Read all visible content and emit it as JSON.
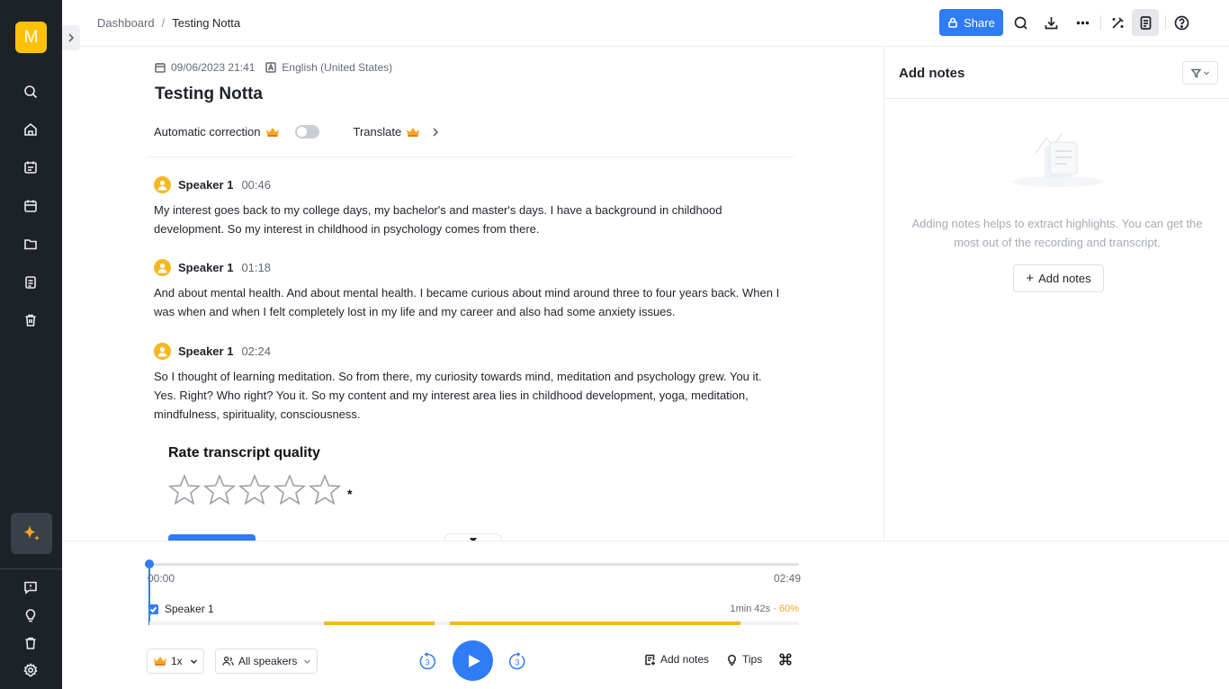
{
  "sidebar": {
    "avatar_letter": "M",
    "icons": [
      "search-icon",
      "home-icon",
      "transcribe-icon",
      "calendar-icon",
      "folder-icon",
      "document-icon",
      "trash-icon"
    ],
    "ai_icon": "sparkle-icon",
    "bottom_icons": [
      "feedback-icon",
      "bulb-icon",
      "trash-icon",
      "settings-icon"
    ]
  },
  "header": {
    "breadcrumb": {
      "root": "Dashboard",
      "separator": "/",
      "current": "Testing Notta"
    },
    "share_label": "Share",
    "icons": [
      "search-icon",
      "download-icon",
      "more-icon",
      "magic-icon",
      "notes-icon",
      "help-icon"
    ]
  },
  "transcript": {
    "date": "09/06/2023 21:41",
    "language": "English (United States)",
    "title": "Testing Notta",
    "auto_correction_label": "Automatic correction",
    "translate_label": "Translate",
    "segments": [
      {
        "speaker": "Speaker 1",
        "time": "00:46",
        "text": "My interest goes back to my college days, my bachelor's and master's days. I have a background in childhood development. So my interest in childhood in psychology comes from there."
      },
      {
        "speaker": "Speaker 1",
        "time": "01:18",
        "text": "And about mental health. And about mental health. I became curious about mind around three to four years back. When I was when and when I felt completely lost in my life and my career and also had some anxiety issues."
      },
      {
        "speaker": "Speaker 1",
        "time": "02:24",
        "text": "So I thought of learning meditation. So from there, my curiosity towards mind, meditation and psychology grew. You it. Yes. Right? Who right? You it. So my content and my interest area lies in childhood development, yoga, meditation, mindfulness, spirituality, consciousness."
      }
    ],
    "rating": {
      "title": "Rate transcript quality",
      "required_mark": "*",
      "star_count": 5,
      "selected": 0
    }
  },
  "notes": {
    "title": "Add notes",
    "empty_text": "Adding notes helps to extract highlights. You can get the most out of the recording and transcript.",
    "add_button": "Add notes"
  },
  "player": {
    "start_time": "00:00",
    "end_time": "02:49",
    "speaker": "Speaker 1",
    "speaker_duration": "1min 42s",
    "speaker_separator": "·",
    "speaker_percent": "60%",
    "speed": "1x",
    "speaker_filter": "All speakers",
    "skip_seconds": "3",
    "add_notes_label": "Add notes",
    "tips_label": "Tips"
  },
  "colors": {
    "accent": "#2f7cf6",
    "speaker": "#f5b820",
    "sidebar": "#1d2228",
    "avatar": "#ffc107"
  }
}
